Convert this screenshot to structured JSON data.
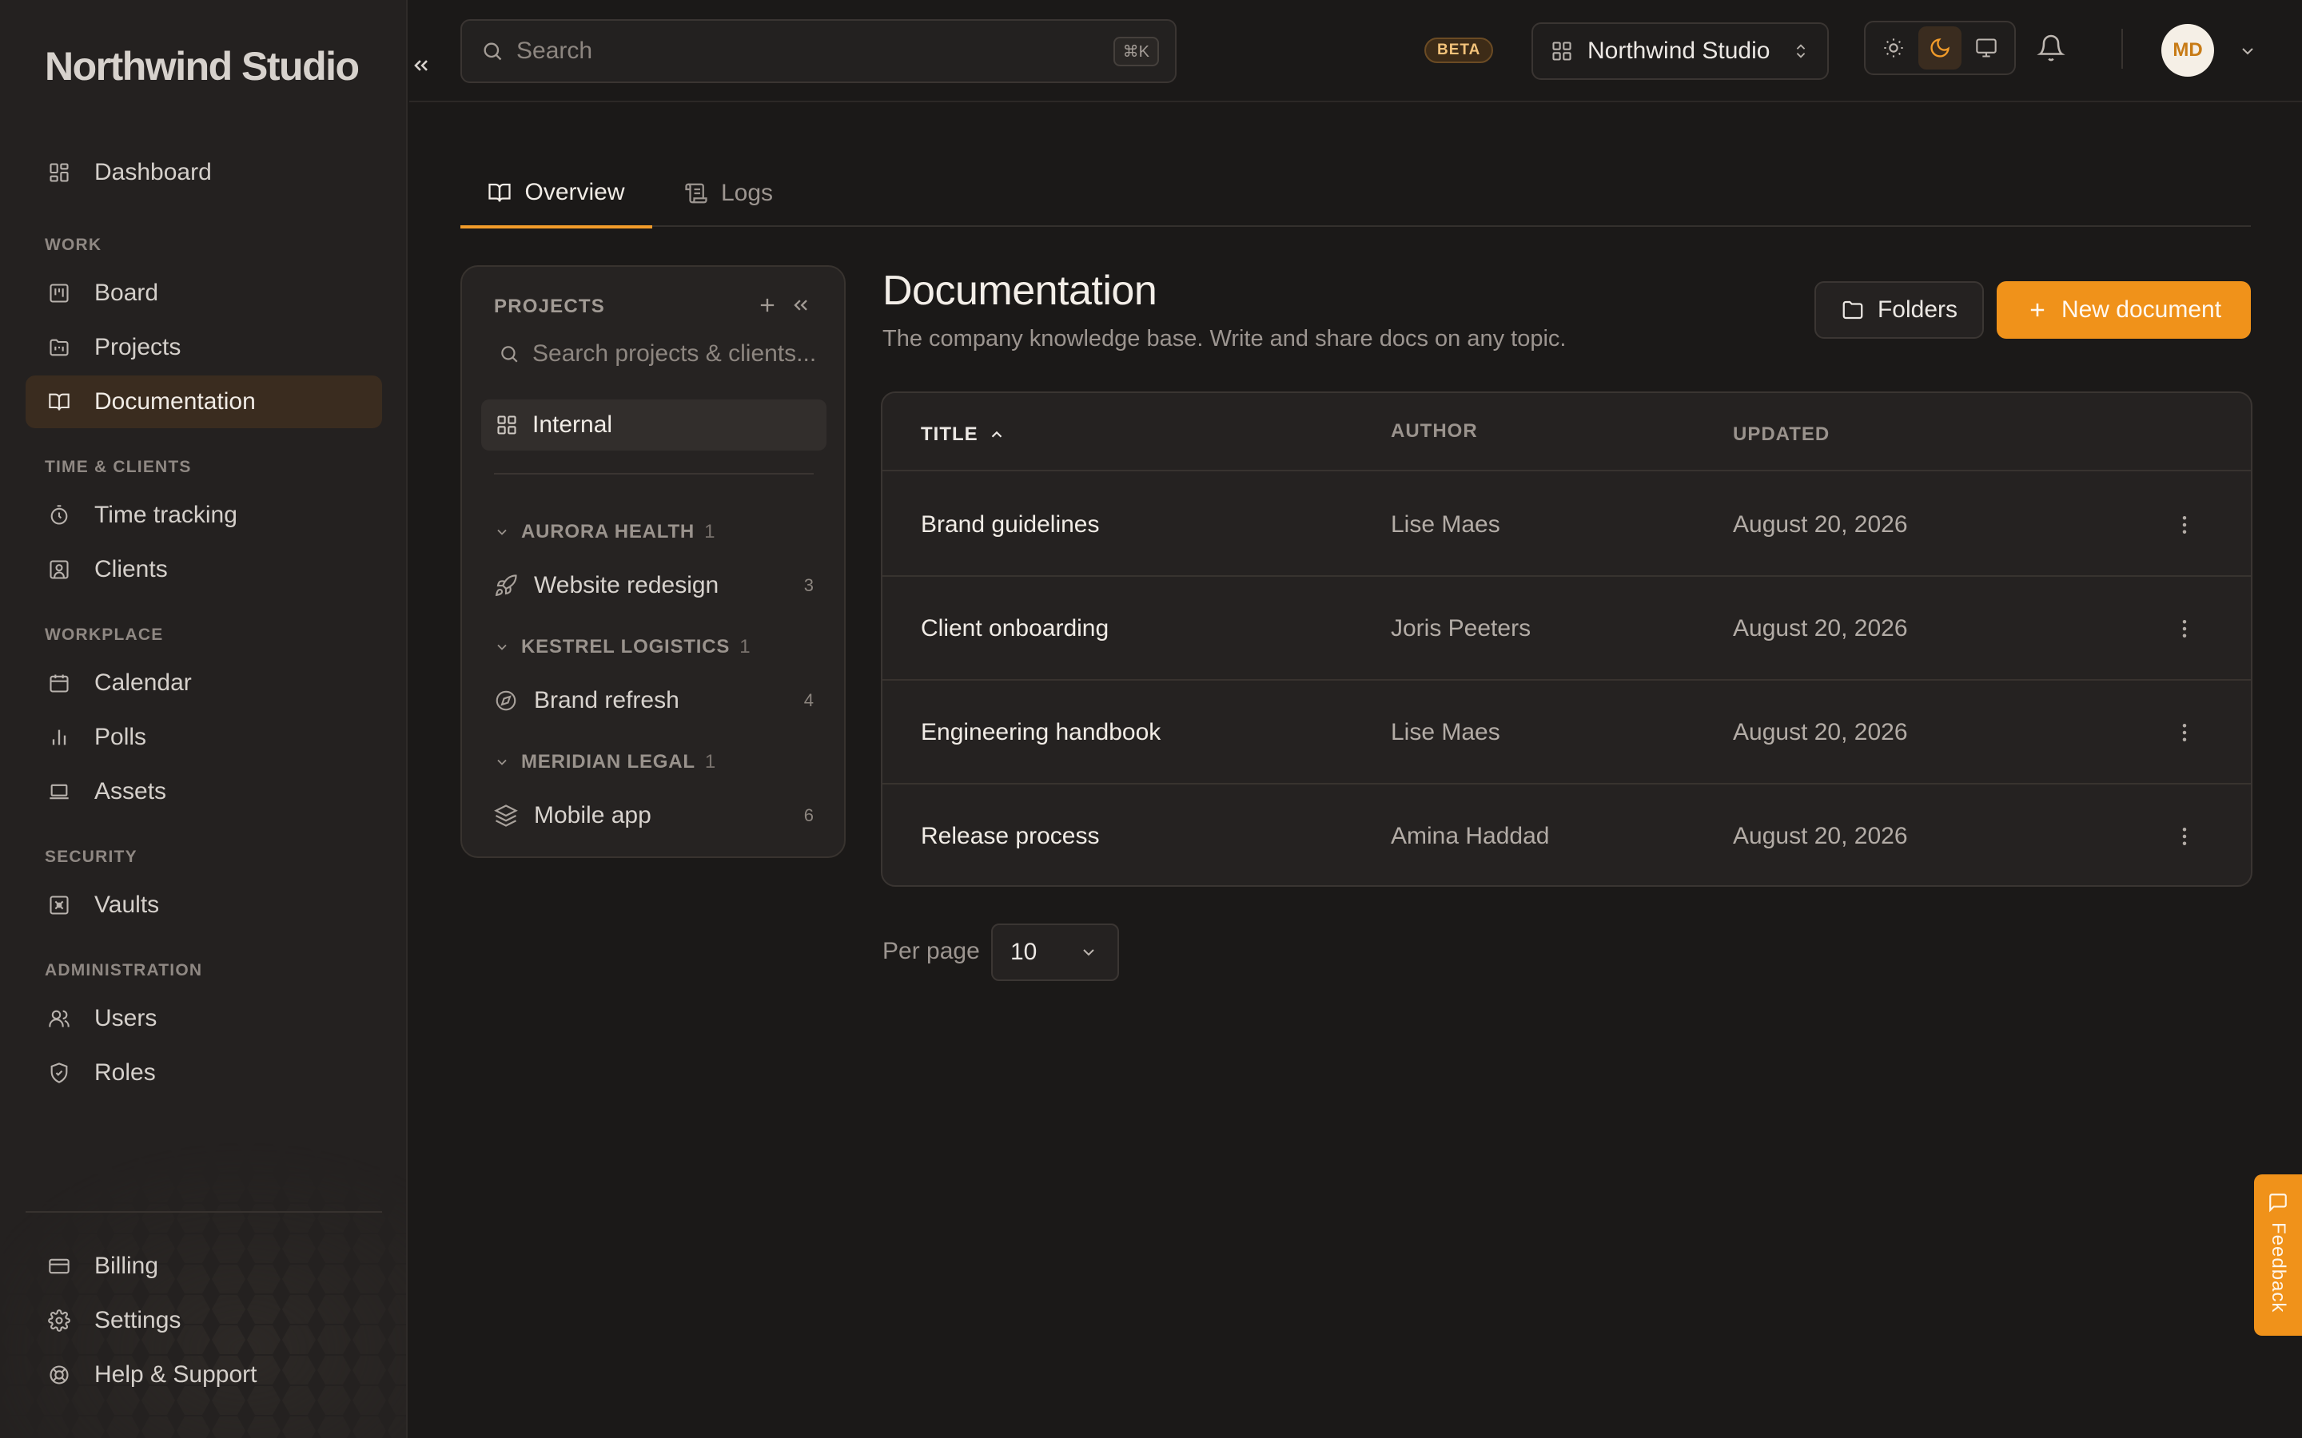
{
  "app": {
    "brand": "Northwind Studio"
  },
  "sidebar": {
    "dashboard": "Dashboard",
    "sections": {
      "work": "WORK",
      "time_clients": "TIME & CLIENTS",
      "workplace": "WORKPLACE",
      "security": "SECURITY",
      "administration": "ADMINISTRATION"
    },
    "items": {
      "board": "Board",
      "projects": "Projects",
      "documentation": "Documentation",
      "time_tracking": "Time tracking",
      "clients": "Clients",
      "calendar": "Calendar",
      "polls": "Polls",
      "assets": "Assets",
      "vaults": "Vaults",
      "users": "Users",
      "roles": "Roles"
    },
    "footer": {
      "billing": "Billing",
      "settings": "Settings",
      "help": "Help & Support"
    },
    "active": "documentation"
  },
  "topbar": {
    "search_placeholder": "Search",
    "search_shortcut": "⌘K",
    "beta": "BETA",
    "workspace": "Northwind Studio",
    "theme_selected": "dark",
    "avatar_initials": "MD"
  },
  "tabs": [
    {
      "label": "Overview",
      "active": true
    },
    {
      "label": "Logs",
      "active": false
    }
  ],
  "projects_panel": {
    "header": "PROJECTS",
    "search_placeholder": "Search projects & clients...",
    "internal": "Internal",
    "groups": [
      {
        "name": "AURORA HEALTH",
        "count": "1",
        "project": "Website redesign",
        "project_count": "3",
        "icon": "rocket-icon"
      },
      {
        "name": "KESTREL LOGISTICS",
        "count": "1",
        "project": "Brand refresh",
        "project_count": "4",
        "icon": "compass-icon"
      },
      {
        "name": "MERIDIAN LEGAL",
        "count": "1",
        "project": "Mobile app",
        "project_count": "6",
        "icon": "layers-icon"
      }
    ]
  },
  "main": {
    "title": "Documentation",
    "subtitle": "The company knowledge base. Write and share docs on any topic.",
    "folders_button": "Folders",
    "new_button": "New document",
    "table": {
      "columns": {
        "title": "TITLE",
        "author": "AUTHOR",
        "updated": "UPDATED"
      },
      "sort": {
        "column": "title",
        "direction": "asc"
      },
      "rows": [
        {
          "title": "Brand guidelines",
          "author": "Lise Maes",
          "updated": "August 20, 2026"
        },
        {
          "title": "Client onboarding",
          "author": "Joris Peeters",
          "updated": "August 20, 2026"
        },
        {
          "title": "Engineering handbook",
          "author": "Lise Maes",
          "updated": "August 20, 2026"
        },
        {
          "title": "Release process",
          "author": "Amina Haddad",
          "updated": "August 20, 2026"
        }
      ]
    },
    "per_page_label": "Per page",
    "per_page_value": "10"
  },
  "feedback": "Feedback",
  "colors": {
    "accent": "#f0921a",
    "background": "#1b1918",
    "sidebar": "#242120"
  }
}
